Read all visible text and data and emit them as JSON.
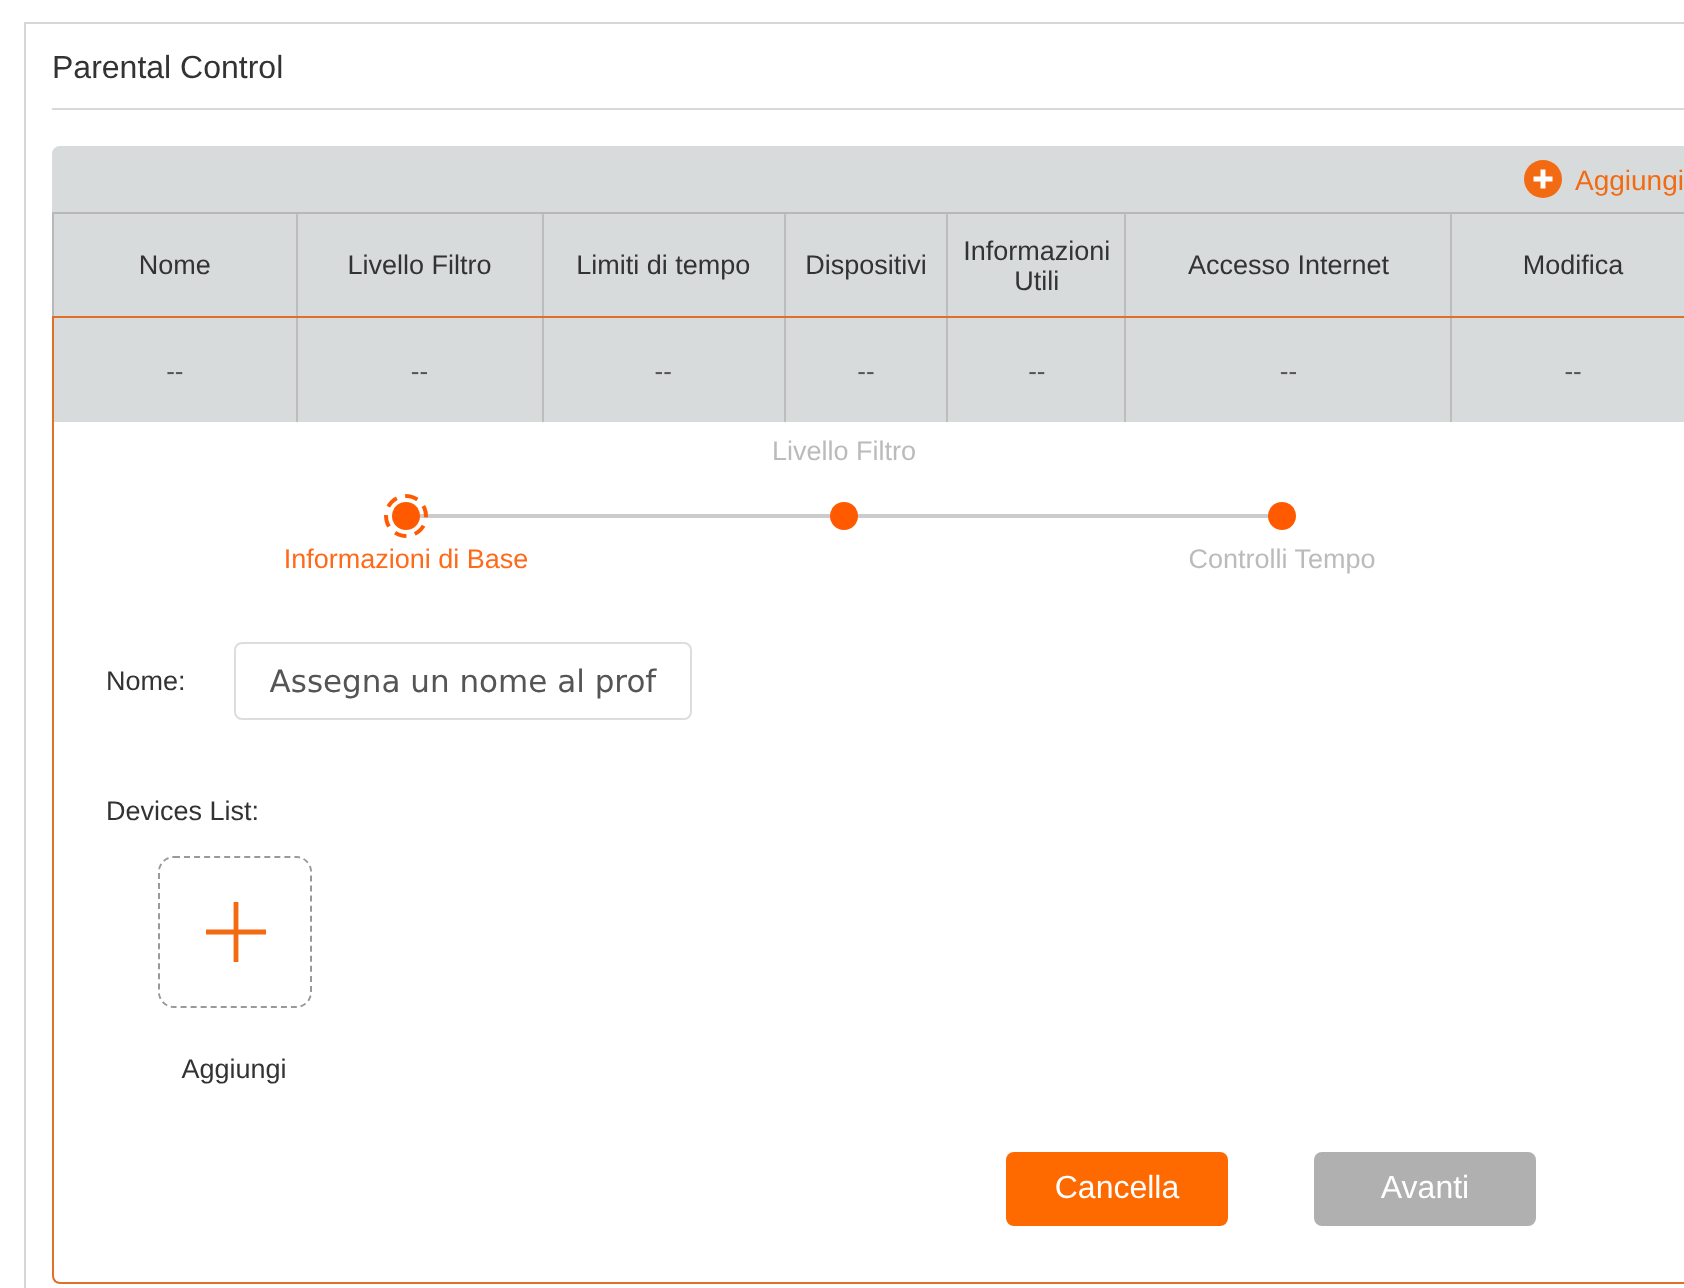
{
  "panel": {
    "title": "Parental Control"
  },
  "toolbar": {
    "add_label": "Aggiungi"
  },
  "table": {
    "columns": [
      "Nome",
      "Livello Filtro",
      "Limiti di tempo",
      "Dispositivi",
      "Informazioni Utili",
      "Accesso Internet",
      "Modifica"
    ],
    "rows": [
      [
        "--",
        "--",
        "--",
        "--",
        "--",
        "--",
        "--"
      ]
    ]
  },
  "steps": [
    {
      "label": "Informazioni di Base",
      "selected": true
    },
    {
      "label": "Livello Filtro",
      "selected": false
    },
    {
      "label": "Controlli Tempo",
      "selected": false
    }
  ],
  "name_field": {
    "label": "Nome:",
    "placeholder": "Assegna un nome al prof"
  },
  "devices": {
    "label": "Devices List:",
    "add_label": "Aggiungi"
  },
  "buttons": [
    {
      "label": "Cancella",
      "disabled": false
    },
    {
      "label": "Avanti",
      "disabled": true
    }
  ]
}
